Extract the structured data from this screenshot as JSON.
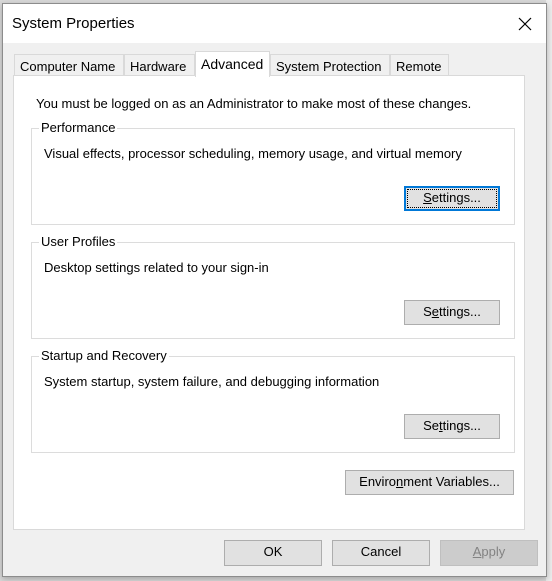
{
  "window": {
    "title": "System Properties",
    "close_icon": "close-icon"
  },
  "tabs": [
    {
      "label": "Computer Name",
      "active": false
    },
    {
      "label": "Hardware",
      "active": false
    },
    {
      "label": "Advanced",
      "active": true
    },
    {
      "label": "System Protection",
      "active": false
    },
    {
      "label": "Remote",
      "active": false
    }
  ],
  "advanced": {
    "notice": "You must be logged on as an Administrator to make most of these changes.",
    "groups": [
      {
        "label": "Performance",
        "description": "Visual effects, processor scheduling, memory usage, and virtual memory",
        "button": {
          "pre": "",
          "mnemonic": "S",
          "post": "ettings...",
          "focused": true
        }
      },
      {
        "label": "User Profiles",
        "description": "Desktop settings related to your sign-in",
        "button": {
          "pre": "S",
          "mnemonic": "e",
          "post": "ttings...",
          "focused": false
        }
      },
      {
        "label": "Startup and Recovery",
        "description": "System startup, system failure, and debugging information",
        "button": {
          "pre": "Se",
          "mnemonic": "t",
          "post": "tings...",
          "focused": false
        }
      }
    ],
    "env_button": {
      "pre": "Enviro",
      "mnemonic": "n",
      "post": "ment Variables..."
    }
  },
  "footer": {
    "ok": "OK",
    "cancel": "Cancel",
    "apply": {
      "pre": "",
      "mnemonic": "A",
      "post": "pply",
      "disabled": true
    }
  }
}
